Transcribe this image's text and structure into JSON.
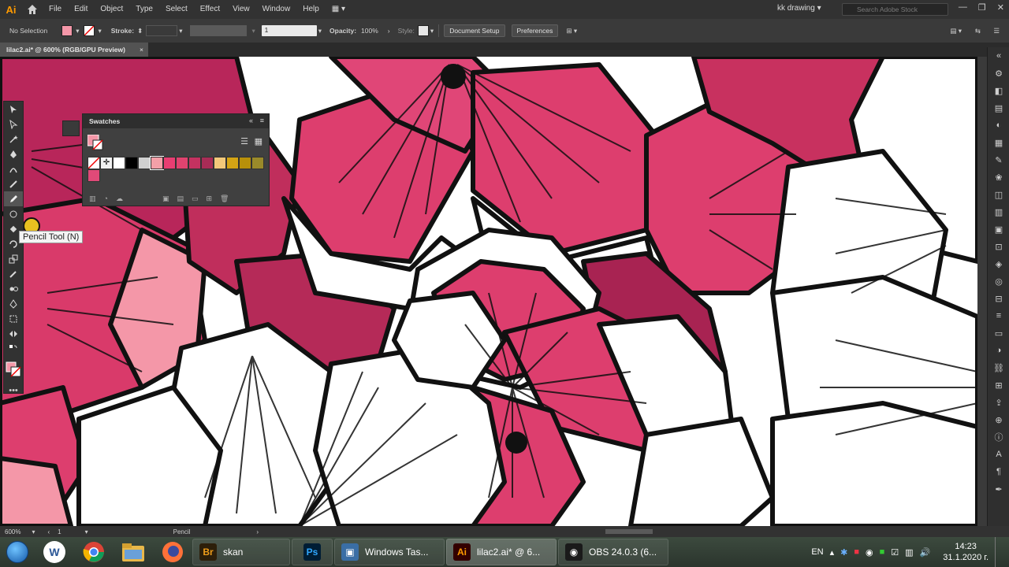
{
  "app": {
    "logo": "Ai"
  },
  "menu": [
    "File",
    "Edit",
    "Object",
    "Type",
    "Select",
    "Effect",
    "View",
    "Window",
    "Help"
  ],
  "workspace": "kk drawing",
  "search_placeholder": "Search Adobe Stock",
  "control": {
    "selection": "No Selection",
    "stroke_label": "Stroke:",
    "stroke_value": "1",
    "opacity_label": "Opacity:",
    "opacity_value": "100%",
    "style_label": "Style:",
    "document_setup": "Document Setup",
    "preferences": "Preferences"
  },
  "doc_tab": {
    "title": "lilac2.ai* @ 600% (RGB/GPU Preview)",
    "close": "×"
  },
  "tooltip": "Pencil Tool (N)",
  "swatches": {
    "title": "Swatches",
    "colors": [
      "#ffffff",
      "#c8c8c8",
      "#000000",
      "#d0d0d0",
      "#f4a0a8",
      "#e83e72",
      "#e0436f",
      "#c43260",
      "#a82c56",
      "#f2c87a",
      "#d4a414",
      "#b8900a",
      "#9a8a2a",
      "#e04a78"
    ]
  },
  "status": {
    "zoom": "600%",
    "artboard": "1",
    "tool": "Pencil"
  },
  "colors": {
    "accent_pink": "#dd3e6e",
    "dark_pink": "#b52a58",
    "light_pink": "#f497a8",
    "ai_orange": "#ff9a00"
  },
  "taskbar": {
    "apps": [
      {
        "label": "skan",
        "icon": "Br",
        "color": "#2d1f0a",
        "fg": "#ee9d1a"
      },
      {
        "label": "",
        "icon": "Ps",
        "color": "#001d34",
        "fg": "#31a8ff"
      },
      {
        "label": "Windows Tas...",
        "icon": "▣",
        "color": "#3a6ea5",
        "fg": "#ffffff"
      },
      {
        "label": "lilac2.ai* @ 6...",
        "icon": "Ai",
        "color": "#330000",
        "fg": "#ff9a00"
      },
      {
        "label": "OBS 24.0.3 (6...",
        "icon": "◉",
        "color": "#1a1a1a",
        "fg": "#ffffff"
      }
    ],
    "lang": "EN",
    "time": "14:23",
    "date": "31.1.2020 г."
  }
}
